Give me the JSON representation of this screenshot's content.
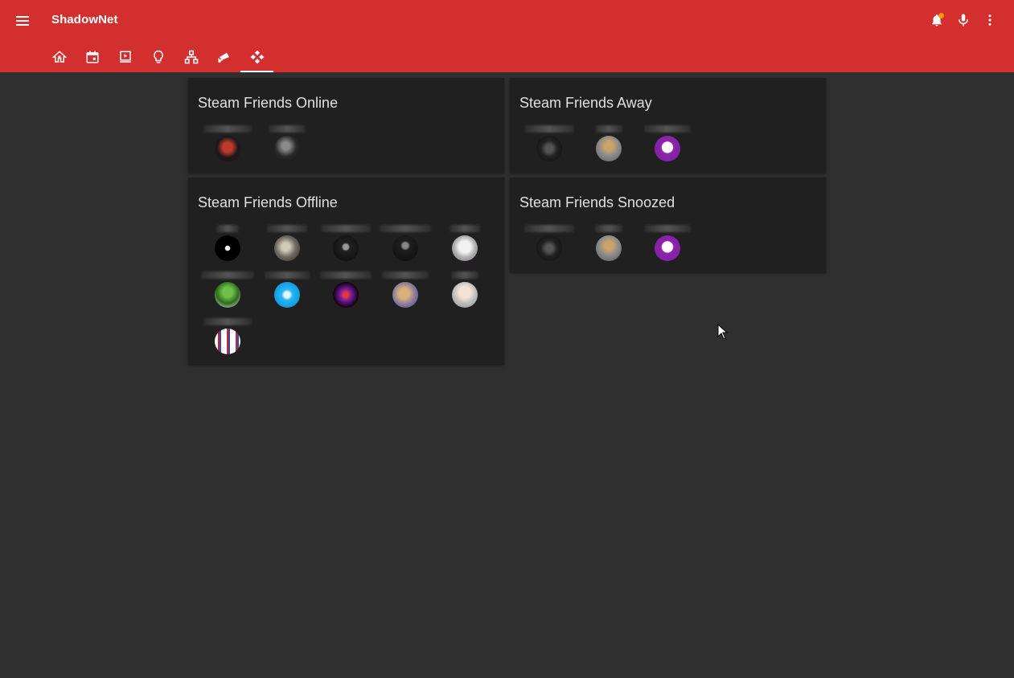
{
  "app": {
    "title": "ShadowNet"
  },
  "header": {
    "menu_icon": "menu-icon",
    "actions": [
      "bell-icon",
      "microphone-icon",
      "more-vertical-icon"
    ],
    "notification_dot_color": "#ff9800",
    "accent_color": "#d32f2f"
  },
  "tabs": [
    {
      "icon": "home-icon",
      "active": false
    },
    {
      "icon": "calendar-icon",
      "active": false
    },
    {
      "icon": "media-icon",
      "active": false
    },
    {
      "icon": "lightbulb-icon",
      "active": false
    },
    {
      "icon": "network-icon",
      "active": false
    },
    {
      "icon": "cctv-icon",
      "active": false
    },
    {
      "icon": "gamepad-icon",
      "active": true
    }
  ],
  "cards": {
    "online": {
      "title": "Steam Friends Online"
    },
    "away": {
      "title": "Steam Friends Away"
    },
    "offline": {
      "title": "Steam Friends Offline"
    },
    "snoozed": {
      "title": "Steam Friends Snoozed"
    }
  }
}
